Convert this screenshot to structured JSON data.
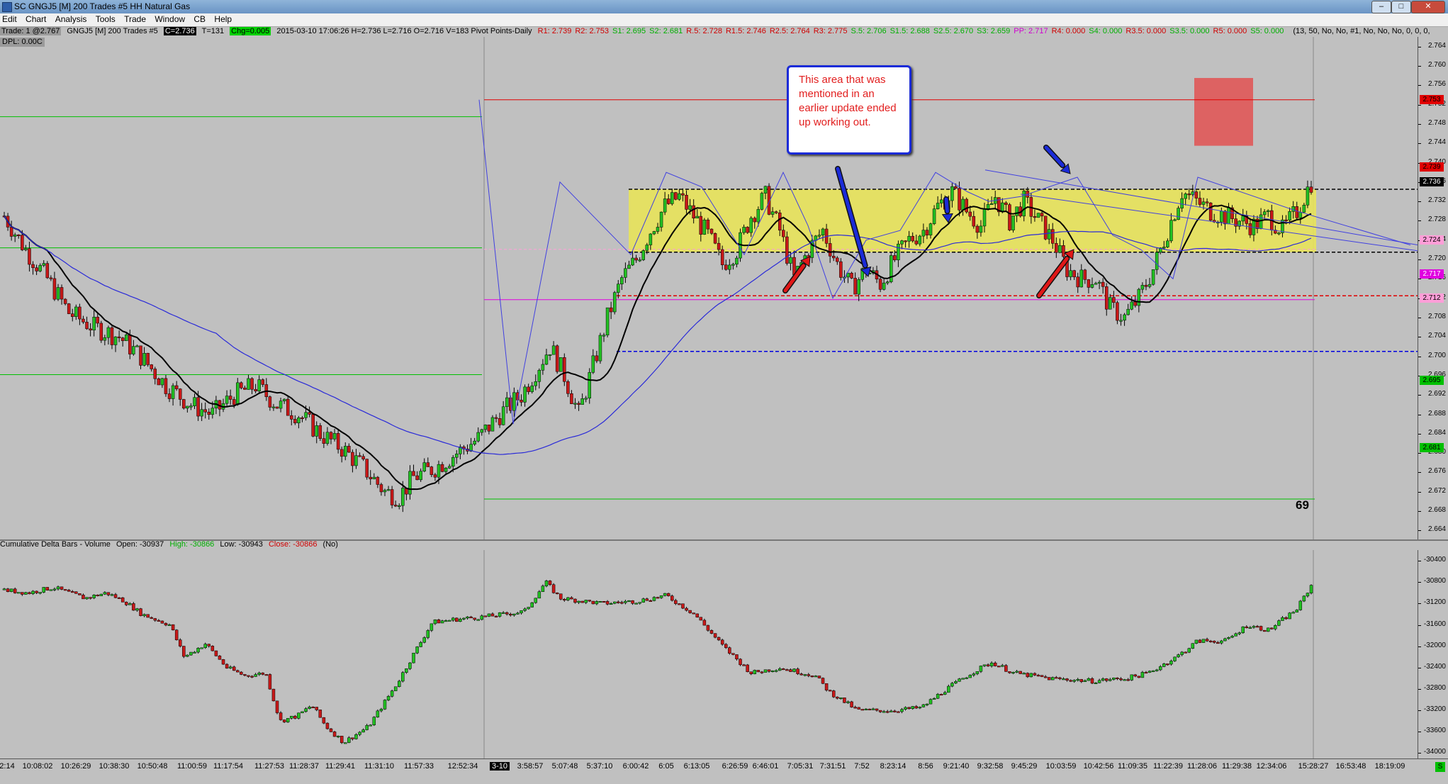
{
  "window": {
    "title": "SC GNGJ5 [M]  200 Trades  #5  HH Natural Gas",
    "controls": [
      "–",
      "□",
      "✕"
    ]
  },
  "menu": [
    "Edit",
    "Chart",
    "Analysis",
    "Tools",
    "Trade",
    "Window",
    "CB",
    "Help"
  ],
  "infobar": {
    "trade": "Trade: 1 @2.767",
    "symbol": "GNGJ5 [M]  200 Trades  #5",
    "close": "C=2.736",
    "trades": "T=131",
    "change": "Chg=0.005",
    "bar_info": "2015-03-10 17:06:26 H=2.736 L=2.716 O=2.716 V=183 Pivot Points-Daily",
    "pivots": [
      {
        "text": "R1: 2.739",
        "color": "#d00000"
      },
      {
        "text": "R2: 2.753",
        "color": "#d00000"
      },
      {
        "text": "S1: 2.695",
        "color": "#00b000"
      },
      {
        "text": "S2: 2.681",
        "color": "#00b000"
      },
      {
        "text": "R.5: 2.728",
        "color": "#d00000"
      },
      {
        "text": "R1.5: 2.746",
        "color": "#d00000"
      },
      {
        "text": "R2.5: 2.764",
        "color": "#d00000"
      },
      {
        "text": "R3: 2.775",
        "color": "#d00000"
      },
      {
        "text": "S.5: 2.706",
        "color": "#00b000"
      },
      {
        "text": "S1.5: 2.688",
        "color": "#00b000"
      },
      {
        "text": "S2.5: 2.670",
        "color": "#00b000"
      },
      {
        "text": "S3: 2.659",
        "color": "#00b000"
      },
      {
        "text": "PP: 2.717",
        "color": "#d000d0"
      },
      {
        "text": "R4: 0.000",
        "color": "#d00000"
      },
      {
        "text": "S4: 0.000",
        "color": "#00b000"
      },
      {
        "text": "R3.5: 0.000",
        "color": "#d00000"
      },
      {
        "text": "S3.5: 0.000",
        "color": "#00b000"
      },
      {
        "text": "R5: 0.000",
        "color": "#d00000"
      },
      {
        "text": "S5: 0.000",
        "color": "#00b000"
      }
    ],
    "params": "(13, 50, No, No, #1, No, No, No, 0, 0, 0,"
  },
  "dpl": "DPL: 0.00C",
  "price_axis": {
    "labels": [
      "2.764",
      "2.760",
      "2.756",
      "2.752",
      "2.748",
      "2.744",
      "2.740",
      "2.736",
      "2.732",
      "2.728",
      "2.724",
      "2.720",
      "2.716",
      "2.712",
      "2.708",
      "2.704",
      "2.700",
      "2.696",
      "2.692",
      "2.688",
      "2.684",
      "2.680",
      "2.676",
      "2.672",
      "2.668",
      "2.664"
    ],
    "markers": [
      {
        "value": 2.753,
        "text": "2.753",
        "bg": "#e00000",
        "fg": "#000"
      },
      {
        "value": 2.739,
        "text": "2.739",
        "bg": "#e00000",
        "fg": "#000"
      },
      {
        "value": 2.736,
        "text": "2.736",
        "bg": "#000000",
        "fg": "#fff"
      },
      {
        "value": 2.724,
        "text": "2.724",
        "bg": "#ff9ed8",
        "fg": "#000"
      },
      {
        "value": 2.717,
        "text": "2.717",
        "bg": "#e000e0",
        "fg": "#fff"
      },
      {
        "value": 2.712,
        "text": "2.712",
        "bg": "#ff9ed8",
        "fg": "#000"
      },
      {
        "value": 2.695,
        "text": "2.695",
        "bg": "#00c000",
        "fg": "#000"
      },
      {
        "value": 2.681,
        "text": "2.681",
        "bg": "#00c000",
        "fg": "#000"
      }
    ]
  },
  "delta_header": {
    "name": "Cumulative Delta Bars - Volume",
    "open": "Open: -30937",
    "high": "High: -30866",
    "low": "Low: -30943",
    "close": "Close: -30866",
    "flag": "(No)"
  },
  "delta_axis": {
    "labels": [
      "-30400",
      "-30800",
      "-31200",
      "-31600",
      "-32000",
      "-32400",
      "-32800",
      "-33200",
      "-33600",
      "-34000"
    ]
  },
  "time_axis": {
    "labels": [
      "2:14",
      "10:08:02",
      "10:26:29",
      "10:38:30",
      "10:50:48",
      "11:00:59",
      "11:17:54",
      "11:27:53",
      "11:28:37",
      "11:29:41",
      "11:31:10",
      "11:57:33",
      "12:52:34",
      "3-10",
      "3:58:57",
      "5:07:48",
      "5:37:10",
      "6:00:42",
      "6:05",
      "6:13:05",
      "6:26:59",
      "6:46:01",
      "7:05:31",
      "7:31:51",
      "7:52",
      "8:23:14",
      "8:56",
      "9:21:40",
      "9:32:58",
      "9:45:29",
      "10:03:59",
      "10:42:56",
      "11:09:35",
      "11:22:39",
      "11:28:06",
      "11:29:38",
      "12:34:06",
      "15:28:27",
      "16:53:48",
      "18:19:09"
    ],
    "corner": "S"
  },
  "callout": {
    "text": "This area that was mentioned in an earlier update ended up working out."
  },
  "bar_count": "69",
  "chart_data": {
    "type": "candlestick",
    "price_range": [
      2.662,
      2.766
    ],
    "delta_range": [
      -34100,
      -30200
    ],
    "zone": {
      "top": 2.7345,
      "bottom": 2.7215
    },
    "levels": [
      {
        "price": 2.753,
        "color": "#e00000"
      },
      {
        "price": 2.7345,
        "color": "#000000"
      },
      {
        "price": 2.7215,
        "color": "#000000"
      },
      {
        "price": 2.7125,
        "color": "#e00000"
      },
      {
        "price": 2.701,
        "color": "#0000e0"
      },
      {
        "price": 2.717,
        "color": "#e000e0"
      },
      {
        "price": 2.695,
        "color": "#00c000"
      },
      {
        "price": 2.681,
        "color": "#00c000"
      }
    ],
    "annotation_markers": [
      "red-arrow",
      "blue-arrow",
      "red-target-box"
    ]
  }
}
